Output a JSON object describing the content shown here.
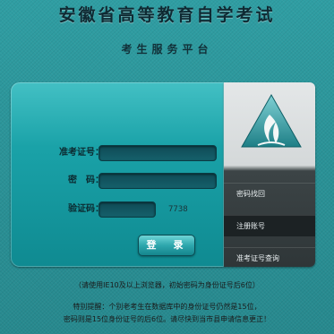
{
  "header": {
    "site_title": "安徽省高等教育自学考试",
    "platform_title": "考生服务平台"
  },
  "login": {
    "ticket_label": "准考证号：",
    "password_label": "密　码：",
    "captcha_label": "验证码：",
    "captcha_code": "7738",
    "login_button": "登　录"
  },
  "side_menu": {
    "items": [
      "密码找回",
      "注册账号",
      "准考证号查询"
    ]
  },
  "notice": {
    "line1": "（请使用IE10及以上浏览器，初始密码为身份证号后6位）",
    "line2": "特别提醒：个别老考生在数据库中的身份证号仍然是15位，",
    "line3": "密码则是15位身份证号的后6位。请尽快到当市县申请信息更正！"
  },
  "colors": {
    "background": "#2a9297",
    "panel": "#1aa2a8",
    "side_dark": "#2f3638"
  }
}
